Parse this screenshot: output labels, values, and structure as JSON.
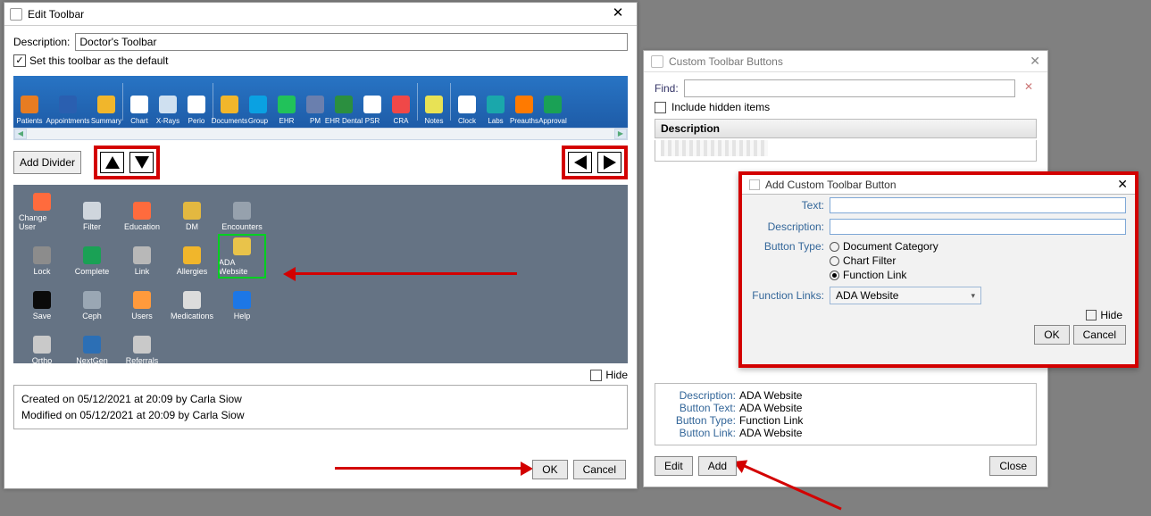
{
  "edit_toolbar": {
    "title": "Edit Toolbar",
    "desc_label": "Description:",
    "desc_value": "Doctor's Toolbar",
    "default_label": "Set this toolbar as the default",
    "default_checked": true,
    "add_divider": "Add Divider",
    "hide_label": "Hide",
    "ok": "OK",
    "cancel": "Cancel",
    "created_line": "Created on 05/12/2021 at 20:09 by Carla Siow",
    "modified_line": "Modified on 05/12/2021 at 20:09 by Carla Siow",
    "toolbar_items": [
      {
        "label": "Patients",
        "color": "#e77c22"
      },
      {
        "label": "Appointments",
        "color": "#2a5fb0",
        "wide": true
      },
      {
        "label": "Summary",
        "color": "#f1b62b"
      },
      {
        "label": "Chart",
        "color": "#ffffff"
      },
      {
        "label": "X-Rays",
        "color": "#cfe0f0"
      },
      {
        "label": "Perio",
        "color": "#ffffff"
      },
      {
        "label": "Documents",
        "color": "#f1b62b"
      },
      {
        "label": "Group",
        "color": "#0aa1e2"
      },
      {
        "label": "EHR",
        "color": "#21c25a"
      },
      {
        "label": "PM",
        "color": "#6a7fae"
      },
      {
        "label": "EHR Dental",
        "color": "#2b8f3f"
      },
      {
        "label": "PSR",
        "color": "#ffffff"
      },
      {
        "label": "CRA",
        "color": "#f04848"
      },
      {
        "label": "Notes",
        "color": "#e8e255"
      },
      {
        "label": "Clock",
        "color": "#ffffff"
      },
      {
        "label": "Labs",
        "color": "#1aa7ab"
      },
      {
        "label": "Preauths",
        "color": "#ff7a00"
      },
      {
        "label": "Approval",
        "color": "#1aa155"
      }
    ],
    "available_items": [
      {
        "label": "Change User",
        "color": "#ff6b3d"
      },
      {
        "label": "Filter",
        "color": "#cfd6dd"
      },
      {
        "label": "Education",
        "color": "#ff6b3d"
      },
      {
        "label": "DM",
        "color": "#e3b840"
      },
      {
        "label": "Encounters",
        "color": "#96a1ad"
      },
      {
        "label": "Lock",
        "color": "#8c8c8c"
      },
      {
        "label": "Complete",
        "color": "#1aa155"
      },
      {
        "label": "Link",
        "color": "#b8b8b8"
      },
      {
        "label": "Allergies",
        "color": "#f1b62b"
      },
      {
        "label": "ADA Website",
        "color": "#e9c34a",
        "selected": true
      },
      {
        "label": "Save",
        "color": "#0a0a0a"
      },
      {
        "label": "Ceph",
        "color": "#9aa7b4"
      },
      {
        "label": "Users",
        "color": "#ff9a3c"
      },
      {
        "label": "Medications",
        "color": "#dcdcdc"
      },
      {
        "label": "Help",
        "color": "#1d77e6"
      },
      {
        "label": "Ortho",
        "color": "#c9c9c9"
      },
      {
        "label": "NextGen",
        "color": "#2c6fb5"
      },
      {
        "label": "Referrals",
        "color": "#c9c9c9"
      }
    ]
  },
  "custom_buttons": {
    "title": "Custom Toolbar Buttons",
    "find_label": "Find:",
    "include_hidden": "Include hidden items",
    "list_header": "Description",
    "details": {
      "description_k": "Description:",
      "description_v": "ADA Website",
      "buttontext_k": "Button Text:",
      "buttontext_v": "ADA Website",
      "buttontype_k": "Button Type:",
      "buttontype_v": "Function Link",
      "buttonlink_k": "Button Link:",
      "buttonlink_v": "ADA Website"
    },
    "edit": "Edit",
    "add": "Add",
    "close": "Close"
  },
  "add_dialog": {
    "title": "Add Custom Toolbar Button",
    "text_label": "Text:",
    "text_value": "",
    "desc_label": "Description:",
    "desc_value": "",
    "btype_label": "Button Type:",
    "btype_options": {
      "doc": "Document Category",
      "filter": "Chart Filter",
      "func": "Function Link"
    },
    "btype_selected": "func",
    "flinks_label": "Function Links:",
    "flinks_value": "ADA Website",
    "hide_label": "Hide",
    "ok": "OK",
    "cancel": "Cancel"
  }
}
